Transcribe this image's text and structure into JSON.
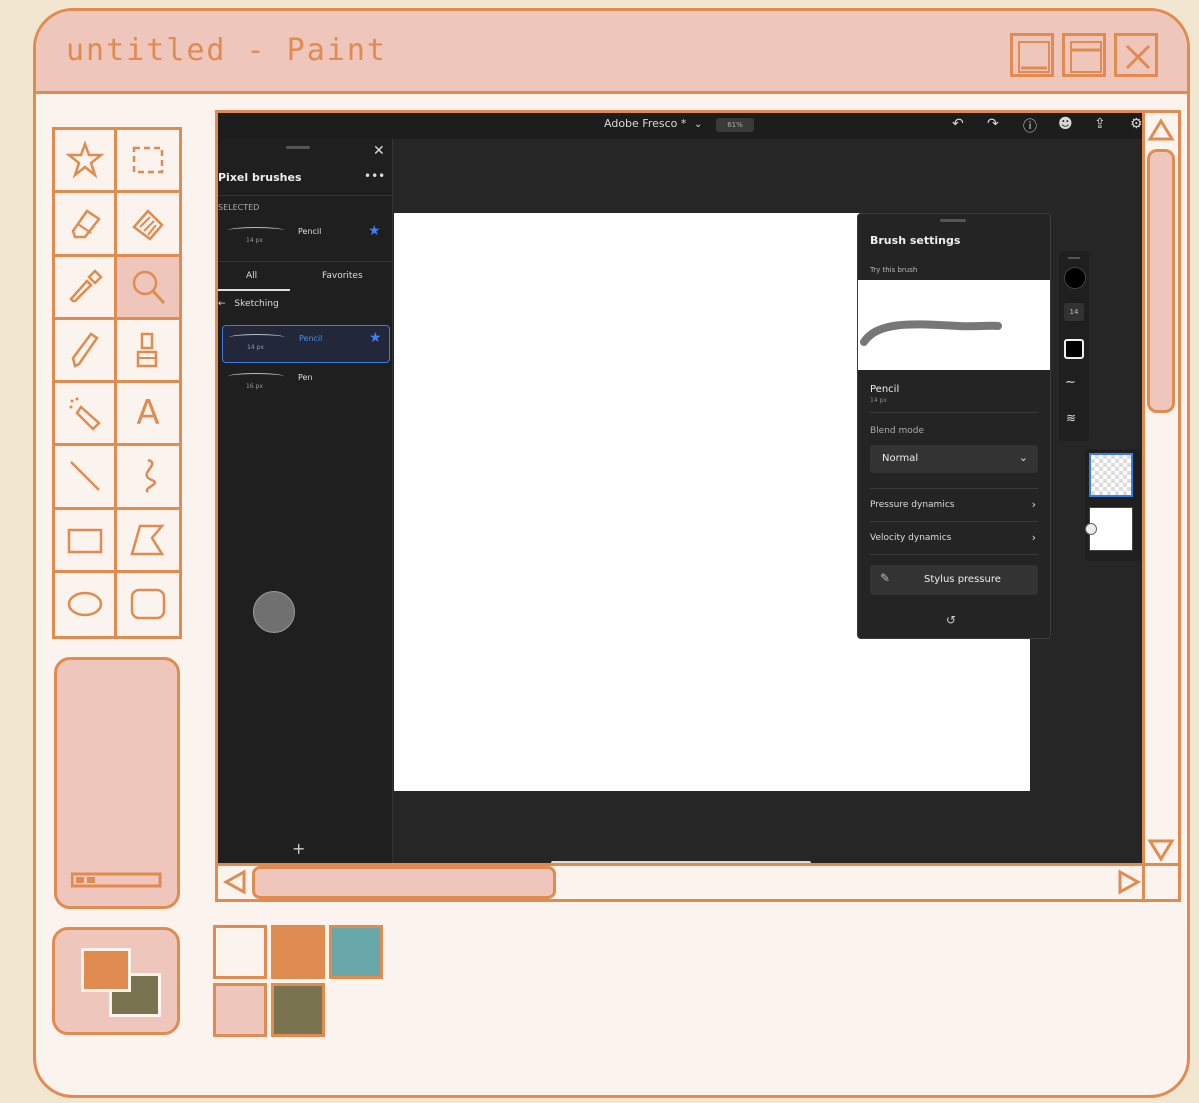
{
  "window": {
    "title": "untitled - Paint"
  },
  "tools": [
    {
      "name": "star-select-icon"
    },
    {
      "name": "rect-select-icon"
    },
    {
      "name": "eraser-icon"
    },
    {
      "name": "fill-icon"
    },
    {
      "name": "eyedropper-icon"
    },
    {
      "name": "magnifier-icon",
      "active": true
    },
    {
      "name": "pencil-icon"
    },
    {
      "name": "brush-icon"
    },
    {
      "name": "airbrush-icon"
    },
    {
      "name": "text-tool",
      "label": "A"
    },
    {
      "name": "line-icon"
    },
    {
      "name": "curve-icon"
    },
    {
      "name": "rectangle-icon"
    },
    {
      "name": "polygon-icon"
    },
    {
      "name": "ellipse-icon"
    },
    {
      "name": "rounded-rect-icon"
    }
  ],
  "palette": {
    "colors": [
      "#fbf3ee",
      "#e08b4f",
      "#67a7a9",
      "#efc6bb",
      "#7a7350"
    ],
    "primary": "#e08b4f",
    "secondary": "#7a7350"
  },
  "fresco": {
    "doc_title": "Adobe Fresco *",
    "zoom": "61%",
    "brushes": {
      "title": "Pixel brushes",
      "section": "SELECTED",
      "selected": {
        "name": "Pencil",
        "size": "14 px"
      },
      "tabs": [
        "All",
        "Favorites"
      ],
      "category": "Sketching",
      "items": [
        {
          "name": "Pencil",
          "size": "14 px"
        },
        {
          "name": "Pen",
          "size": "16 px"
        }
      ]
    },
    "settings": {
      "title": "Brush settings",
      "try_label": "Try this brush",
      "brush_name": "Pencil",
      "brush_size": "14 px",
      "blend_label": "Blend mode",
      "blend_value": "Normal",
      "pressure": "Pressure dynamics",
      "velocity": "Velocity dynamics",
      "stylus": "Stylus pressure"
    },
    "rail_size": "14"
  }
}
